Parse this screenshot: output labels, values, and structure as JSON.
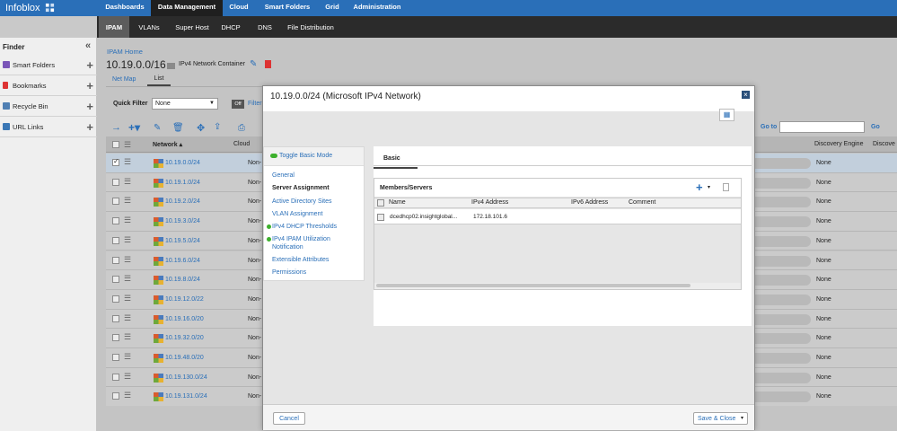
{
  "brand": {
    "logo": "Infoblox"
  },
  "topnav": [
    "Dashboards",
    "Data Management",
    "Cloud",
    "Smart Folders",
    "Grid",
    "Administration"
  ],
  "subnav": [
    "IPAM",
    "VLANs",
    "Super Host",
    "DHCP",
    "DNS",
    "File Distribution"
  ],
  "finder": {
    "title": "Finder",
    "items": [
      "Smart Folders",
      "Bookmarks",
      "Recycle Bin",
      "URL Links"
    ]
  },
  "breadcrumb": "IPAM Home",
  "header": {
    "title": "10.19.0.0/16",
    "type": "IPv4 Network Container"
  },
  "viewtabs": [
    "Net Map",
    "List"
  ],
  "quickfilter": {
    "label": "Quick Filter",
    "value": "None",
    "toggle": "Off",
    "filter_text": "Filter"
  },
  "goto": {
    "label": "Go to",
    "go": "Go"
  },
  "columns": {
    "network": "Network",
    "cloud": "Cloud",
    "discovery": "Discovery Engine",
    "discove": "Discove"
  },
  "rows": [
    {
      "network": "10.19.0.0/24",
      "cloud": "Non-",
      "engine": "None",
      "selected": true
    },
    {
      "network": "10.19.1.0/24",
      "cloud": "Non-",
      "engine": "None",
      "selected": false
    },
    {
      "network": "10.19.2.0/24",
      "cloud": "Non-",
      "engine": "None",
      "selected": false
    },
    {
      "network": "10.19.3.0/24",
      "cloud": "Non-",
      "engine": "None",
      "selected": false
    },
    {
      "network": "10.19.5.0/24",
      "cloud": "Non-",
      "engine": "None",
      "selected": false
    },
    {
      "network": "10.19.6.0/24",
      "cloud": "Non-",
      "engine": "None",
      "selected": false
    },
    {
      "network": "10.19.8.0/24",
      "cloud": "Non-",
      "engine": "None",
      "selected": false
    },
    {
      "network": "10.19.12.0/22",
      "cloud": "Non-",
      "engine": "None",
      "selected": false
    },
    {
      "network": "10.19.16.0/20",
      "cloud": "Non-",
      "engine": "None",
      "selected": false
    },
    {
      "network": "10.19.32.0/20",
      "cloud": "Non-",
      "engine": "None",
      "selected": false
    },
    {
      "network": "10.19.48.0/20",
      "cloud": "Non-",
      "engine": "None",
      "selected": false
    },
    {
      "network": "10.19.130.0/24",
      "cloud": "Non-",
      "engine": "None",
      "selected": false
    },
    {
      "network": "10.19.131.0/24",
      "cloud": "Non-",
      "engine": "None",
      "selected": false
    }
  ],
  "modal": {
    "title": "10.19.0.0/24 (Microsoft IPv4 Network)",
    "toggle": "Toggle Basic Mode",
    "wizard": [
      "General",
      "Server Assignment",
      "Active Directory Sites",
      "VLAN Assignment",
      "IPv4 DHCP Thresholds",
      "IPv4 IPAM Utilization Notification",
      "Extensible Attributes",
      "Permissions"
    ],
    "tab": "Basic",
    "members": {
      "title": "Members/Servers",
      "columns": [
        "Name",
        "IPv4 Address",
        "IPv6 Address",
        "Comment"
      ],
      "rows": [
        {
          "name": "dcedhcp02.insightglobal...",
          "ipv4": "172.18.101.6",
          "ipv6": "",
          "comment": ""
        }
      ]
    },
    "cancel": "Cancel",
    "save": "Save & Close"
  }
}
